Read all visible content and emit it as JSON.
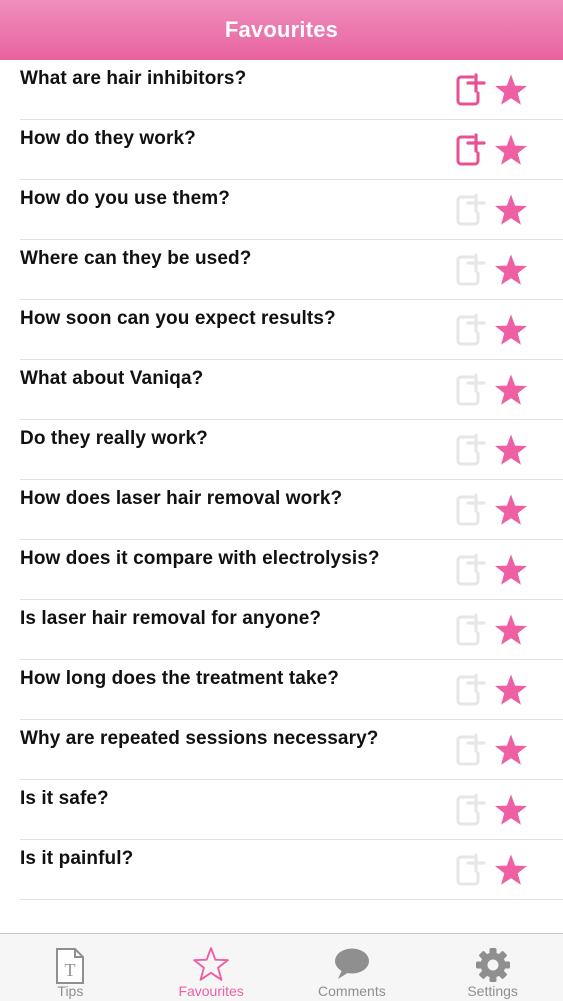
{
  "header": {
    "title": "Favourites"
  },
  "colors": {
    "accent": "#ee5fa3",
    "note_active": "#e94f93",
    "note_inactive": "#e6e6e6",
    "tab_inactive": "#8f8f8f"
  },
  "items": [
    {
      "label": "What are hair inhibitors?",
      "note_icon": "add-note-icon",
      "note_active": true
    },
    {
      "label": "How do they work?",
      "note_icon": "add-note-icon",
      "note_active": true
    },
    {
      "label": "How do you use them?",
      "note_icon": "add-note-icon",
      "note_active": false
    },
    {
      "label": "Where can they be used?",
      "note_icon": "add-note-icon",
      "note_active": false
    },
    {
      "label": "How soon can you expect results?",
      "note_icon": "add-note-icon",
      "note_active": false
    },
    {
      "label": "What about Vaniqa?",
      "note_icon": "add-note-icon",
      "note_active": false
    },
    {
      "label": "Do they really work?",
      "note_icon": "add-note-icon",
      "note_active": false
    },
    {
      "label": "How does laser hair removal work?",
      "note_icon": "add-note-icon",
      "note_active": false
    },
    {
      "label": "How does it compare with electrolysis?",
      "note_icon": "add-note-icon",
      "note_active": false
    },
    {
      "label": "Is laser hair removal for anyone?",
      "note_icon": "add-note-icon",
      "note_active": false
    },
    {
      "label": "How long does the treatment take?",
      "note_icon": "add-note-icon",
      "note_active": false
    },
    {
      "label": "Why are repeated sessions necessary?",
      "note_icon": "add-note-icon",
      "note_active": false
    },
    {
      "label": "Is it safe?",
      "note_icon": "add-note-icon",
      "note_active": false
    },
    {
      "label": "Is it painful?",
      "note_icon": "add-note-icon",
      "note_active": false
    }
  ],
  "tabbar": {
    "tabs": [
      {
        "label": "Tips",
        "icon": "document-icon",
        "active": false
      },
      {
        "label": "Favourites",
        "icon": "star-outline-icon",
        "active": true
      },
      {
        "label": "Comments",
        "icon": "speech-bubble-icon",
        "active": false
      },
      {
        "label": "Settings",
        "icon": "gear-icon",
        "active": false
      }
    ]
  }
}
